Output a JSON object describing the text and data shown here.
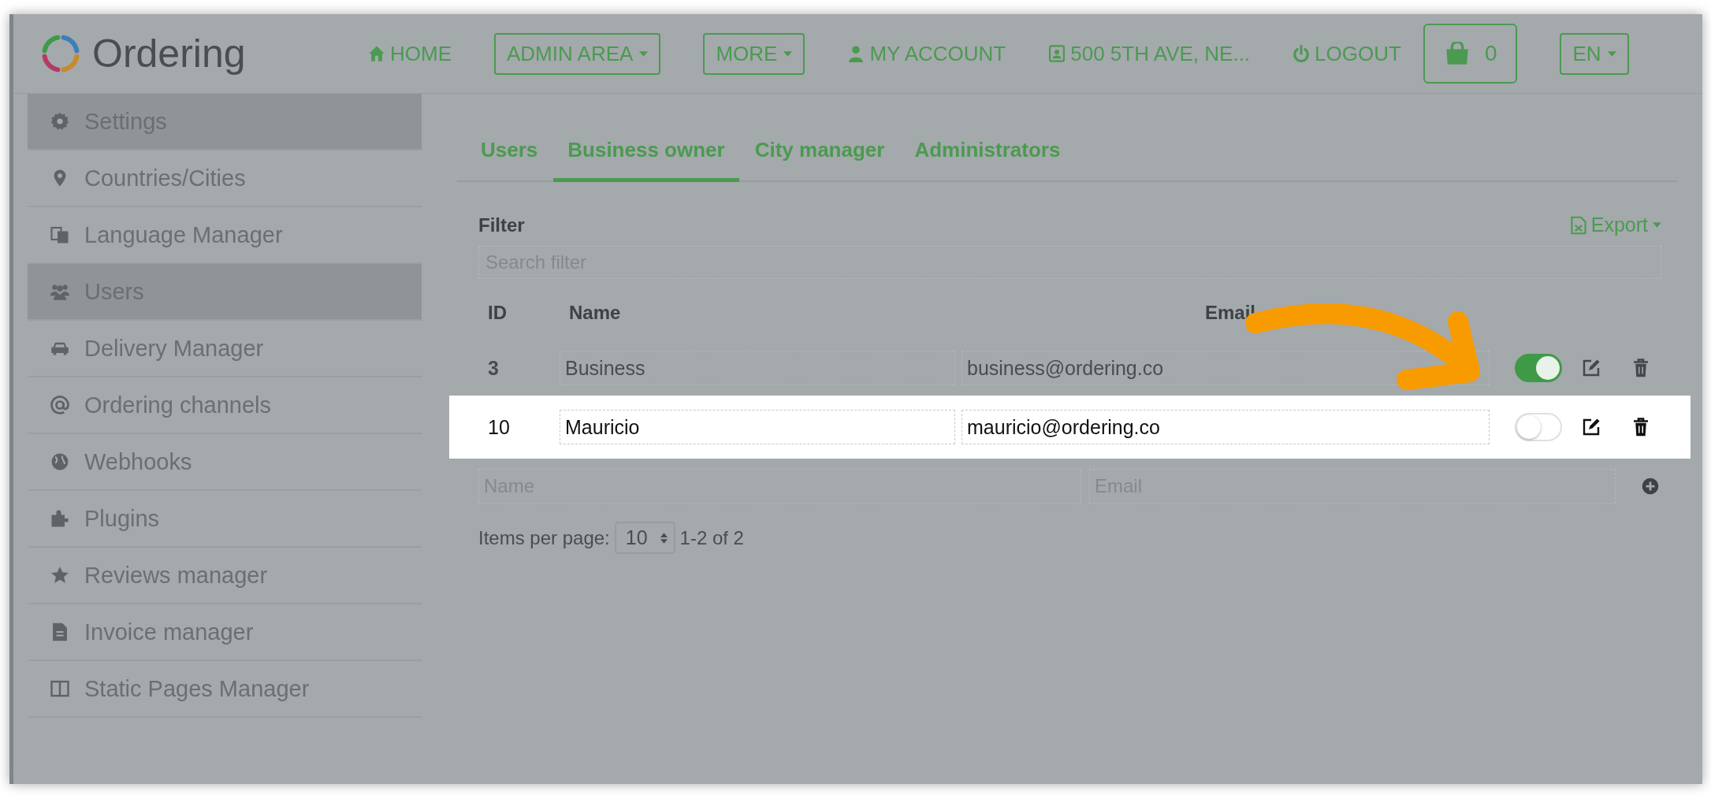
{
  "header": {
    "logo_text": "Ordering",
    "nav": [
      {
        "kind": "link",
        "label": "HOME"
      },
      {
        "kind": "dropdown",
        "label": "ADMIN AREA"
      },
      {
        "kind": "dropdown",
        "label": "MORE"
      },
      {
        "kind": "link",
        "label": "MY ACCOUNT"
      },
      {
        "kind": "link",
        "label": "500 5TH AVE, NE..."
      },
      {
        "kind": "link",
        "label": "LOGOUT"
      },
      {
        "kind": "cart",
        "label": "0"
      },
      {
        "kind": "dropdown",
        "label": "EN"
      }
    ]
  },
  "sidebar": {
    "items": [
      {
        "label": "Settings",
        "selected": true
      },
      {
        "label": "Countries/Cities",
        "selected": false
      },
      {
        "label": "Language Manager",
        "selected": false
      },
      {
        "label": "Users",
        "selected": true
      },
      {
        "label": "Delivery Manager",
        "selected": false
      },
      {
        "label": "Ordering channels",
        "selected": false
      },
      {
        "label": "Webhooks",
        "selected": false
      },
      {
        "label": "Plugins",
        "selected": false
      },
      {
        "label": "Reviews manager",
        "selected": false
      },
      {
        "label": "Invoice manager",
        "selected": false
      },
      {
        "label": "Static Pages Manager",
        "selected": false
      }
    ]
  },
  "tabs": [
    {
      "label": "Users",
      "selected": false
    },
    {
      "label": "Business owner",
      "selected": true
    },
    {
      "label": "City manager",
      "selected": false
    },
    {
      "label": "Administrators",
      "selected": false
    }
  ],
  "filter": {
    "label": "Filter",
    "placeholder": "Search filter",
    "export": "Export"
  },
  "table": {
    "columns": [
      "ID",
      "Name",
      "Email"
    ],
    "rows": [
      {
        "id": "3",
        "name": "Business",
        "email": "business@ordering.co",
        "on": true,
        "highlighted": false
      },
      {
        "id": "10",
        "name": "Mauricio",
        "email": "mauricio@ordering.co",
        "on": false,
        "highlighted": true
      }
    ],
    "new_row": {
      "name_placeholder": "Name",
      "email_placeholder": "Email"
    }
  },
  "pager": {
    "label": "Items per page:",
    "per_page": "10",
    "range": "1-2 of 2"
  }
}
